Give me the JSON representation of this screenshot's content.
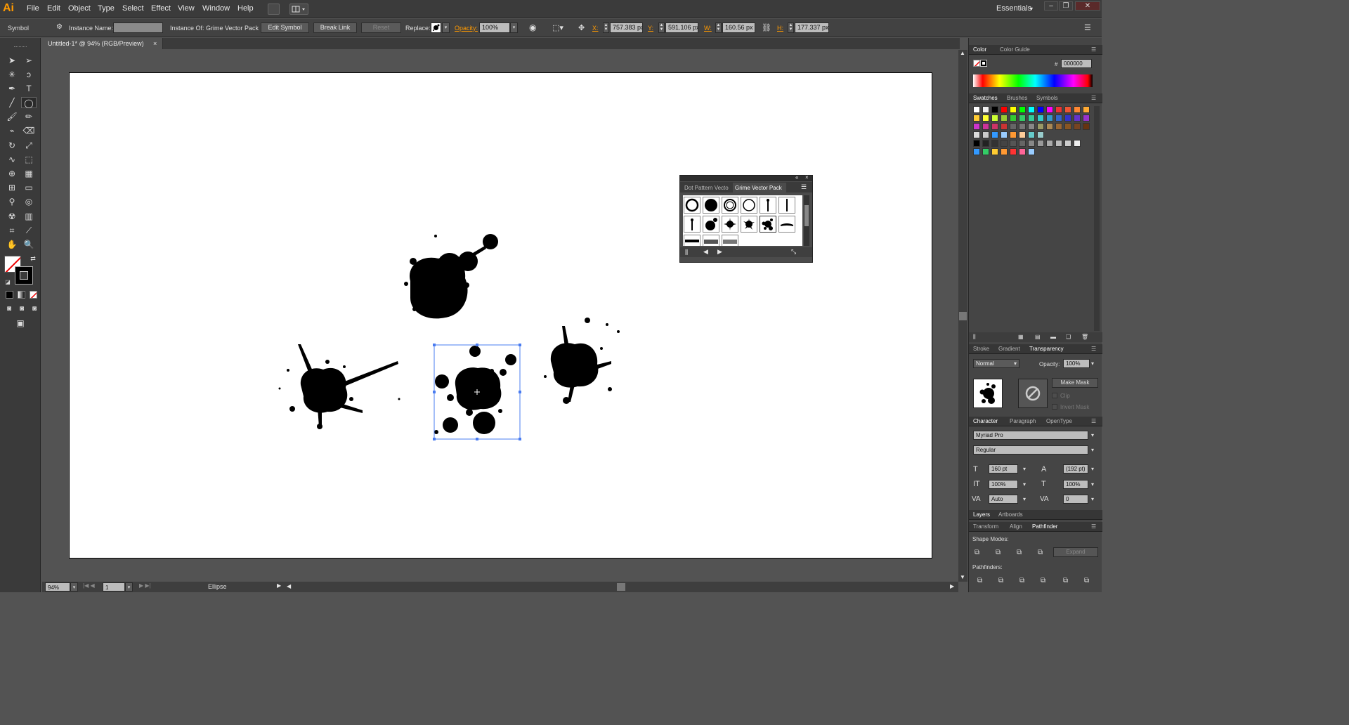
{
  "app": {
    "logo": "Ai",
    "workspace": "Essentials"
  },
  "menu": [
    "File",
    "Edit",
    "Object",
    "Type",
    "Select",
    "Effect",
    "View",
    "Window",
    "Help"
  ],
  "control": {
    "selection_type": "Symbol",
    "instance_name_label": "Instance Name:",
    "instance_of_label": "Instance Of: Grime Vector Pack ...",
    "edit_symbol": "Edit Symbol",
    "break_link": "Break Link",
    "reset": "Reset",
    "replace_label": "Replace:",
    "opacity_label": "Opacity:",
    "opacity_value": "100%",
    "x_label": "X:",
    "x_value": "757.383 px",
    "y_label": "Y:",
    "y_value": "591.106 px",
    "w_label": "W:",
    "w_value": "160.56 px",
    "h_label": "H:",
    "h_value": "177.337 px"
  },
  "document": {
    "tab_title": "Untitled-1* @ 94% (RGB/Preview)"
  },
  "status": {
    "zoom": "94%",
    "artboard": "1",
    "tool": "Ellipse"
  },
  "symbols_panel": {
    "tabs": [
      "Dot Pattern Vecto",
      "Grime Vector Pack"
    ]
  },
  "color_panel": {
    "tabs": [
      "Color",
      "Color Guide"
    ],
    "hex_label": "#",
    "hex_value": "000000"
  },
  "swatches_panel": {
    "tabs": [
      "Swatches",
      "Brushes",
      "Symbols"
    ]
  },
  "transparency_panel": {
    "tabs": [
      "Stroke",
      "Gradient",
      "Transparency"
    ],
    "blend_mode": "Normal",
    "opacity_label": "Opacity:",
    "opacity_value": "100%",
    "make_mask": "Make Mask",
    "clip": "Clip",
    "invert_mask": "Invert Mask"
  },
  "character_panel": {
    "tabs": [
      "Character",
      "Paragraph",
      "OpenType"
    ],
    "font": "Myriad Pro",
    "style": "Regular",
    "size": "160 pt",
    "leading": "(192 pt)",
    "vscale": "100%",
    "hscale": "100%",
    "kerning": "Auto",
    "tracking": "0"
  },
  "layers_panel": {
    "tabs": [
      "Layers",
      "Artboards"
    ]
  },
  "pathfinder_panel": {
    "tabs": [
      "Transform",
      "Align",
      "Pathfinder"
    ],
    "shape_modes": "Shape Modes:",
    "expand": "Expand",
    "pathfinders": "Pathfinders:"
  },
  "colors": {
    "accent": "#ff9a00",
    "selection": "#4a7cf0",
    "ink": "#000000"
  }
}
